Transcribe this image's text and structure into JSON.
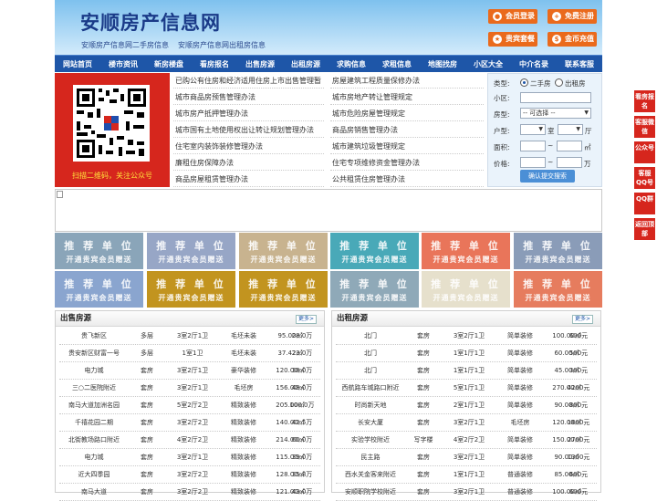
{
  "header": {
    "title": "安顺房产信息网",
    "subtitle1": "安顺房产信息网二手房信息",
    "subtitle2": "安顺房产信息网出租房信息",
    "buttons": [
      {
        "label": "会员登录"
      },
      {
        "label": "免费注册"
      },
      {
        "label": "贵宾套餐"
      },
      {
        "label": "金币充值"
      }
    ]
  },
  "nav": [
    "网站首页",
    "楼市资讯",
    "新房楼盘",
    "看房报名",
    "出售房源",
    "出租房源",
    "求购信息",
    "求租信息",
    "地图找房",
    "小区大全",
    "中介名录",
    "联系客服"
  ],
  "qr": {
    "caption": "扫描二维码，关注公众号"
  },
  "links": {
    "left": [
      "已购公有住房和经济适用住房上市出售管理暂",
      "城市商品房预售管理办法",
      "城市房产抵押管理办法",
      "城市国有土地使用权出让转让规划管理办法",
      "住宅室内装饰装修管理办法",
      "廉租住房保障办法",
      "商品房屋租赁管理办法"
    ],
    "right": [
      "房屋建筑工程质量保修办法",
      "城市房地产转让管理规定",
      "城市危险房屋管理规定",
      "商品房销售管理办法",
      "城市建筑垃圾管理规定",
      "住宅专项维修资金管理办法",
      "公共租赁住房管理办法"
    ]
  },
  "search": {
    "type_label": "类型:",
    "opt_sale": "二手房",
    "opt_rent": "出租房",
    "community_label": "小区:",
    "house_label": "房型:",
    "house_select": "-- 可选择 --",
    "layout_label": "户型:",
    "room_unit": "室",
    "hall_unit": "厅",
    "area_label": "面积:",
    "area_unit": "㎡",
    "price_label": "价格:",
    "price_unit": "万",
    "tilde": "~",
    "submit": "确认提交搜索"
  },
  "recommend": {
    "title": "推 荐 单 位",
    "subtitle": "开通贵宾会员赠送",
    "colors": [
      "#8aa5b9",
      "#97a6c6",
      "#c8b38f",
      "#49a9b8",
      "#e9755a",
      "#8a9cb8",
      "#8aa5cf",
      "#c2941f",
      "#c2941f",
      "#8fa9b8",
      "#e6e0cc",
      "#e67c5e"
    ]
  },
  "sale": {
    "title": "出售房源",
    "more": "更多>",
    "rows": [
      [
        "贵飞新区",
        "多层",
        "3室2厅1卫",
        "毛坯未装",
        "95.00㎡",
        "28.0万"
      ],
      [
        "贵安新区财富一号",
        "多层",
        "1室1卫",
        "毛坯未装",
        "37.42㎡",
        "23.0万"
      ],
      [
        "电力城",
        "套房",
        "3室2厅1卫",
        "豪华装修",
        "120.00㎡",
        "38.0万"
      ],
      [
        "三○二医院附近",
        "套房",
        "3室2厅1卫",
        "毛坯房",
        "156.00㎡",
        "48.0万"
      ],
      [
        "南马大道加洲名园",
        "套房",
        "5室2厅2卫",
        "精致装修",
        "205.00㎡",
        "100.0万"
      ],
      [
        "千禧花园二期",
        "套房",
        "3室2厅2卫",
        "精致装修",
        "140.00㎡",
        "42.5万"
      ],
      [
        "北街教场路口附近",
        "套房",
        "4室2厅2卫",
        "精致装修",
        "214.00㎡",
        "60.0万"
      ],
      [
        "电力城",
        "套房",
        "3室2厅1卫",
        "精致装修",
        "115.00㎡",
        "39.0万"
      ],
      [
        "近大四季园",
        "套房",
        "3室2厅2卫",
        "精致装修",
        "128.00㎡",
        "35.8万"
      ],
      [
        "南马大道",
        "套房",
        "3室2厅2卫",
        "精致装修",
        "121.00㎡",
        "43.0万"
      ]
    ]
  },
  "rent": {
    "title": "出租房源",
    "more": "更多>",
    "rows": [
      [
        "北门",
        "套房",
        "3室2厅1卫",
        "简单装修",
        "100.00㎡",
        "600元"
      ],
      [
        "北门",
        "套房",
        "1室1厅1卫",
        "简单装修",
        "60.00㎡",
        "500元"
      ],
      [
        "北门",
        "套房",
        "1室1厅1卫",
        "简单装修",
        "45.00㎡",
        "300元"
      ],
      [
        "西航路车城路口附近",
        "套房",
        "5室1厅1卫",
        "简单装修",
        "270.00㎡",
        "4200元"
      ],
      [
        "时尚新天地",
        "套房",
        "2室1厅1卫",
        "简单装修",
        "90.00㎡",
        "800元"
      ],
      [
        "长安大厦",
        "套房",
        "3室2厅1卫",
        "毛坯房",
        "120.00㎡",
        "1800元"
      ],
      [
        "实验学校附近",
        "写字楼",
        "4室2厅2卫",
        "简单装修",
        "150.00㎡",
        "2700元"
      ],
      [
        "民主路",
        "套房",
        "3室2厅1卫",
        "简单装修",
        "90.00㎡",
        "1300元"
      ],
      [
        "西水关金客来附近",
        "套房",
        "1室1厅1卫",
        "普通装修",
        "85.00㎡",
        "600元"
      ],
      [
        "安顺职院学校附近",
        "套房",
        "3室2厅1卫",
        "普通装修",
        "100.00㎡",
        "600元"
      ]
    ]
  },
  "sidebar": [
    "看房报名",
    "客服微信",
    "公众号",
    "客服QQ号",
    "QQ群",
    "返回顶部"
  ]
}
